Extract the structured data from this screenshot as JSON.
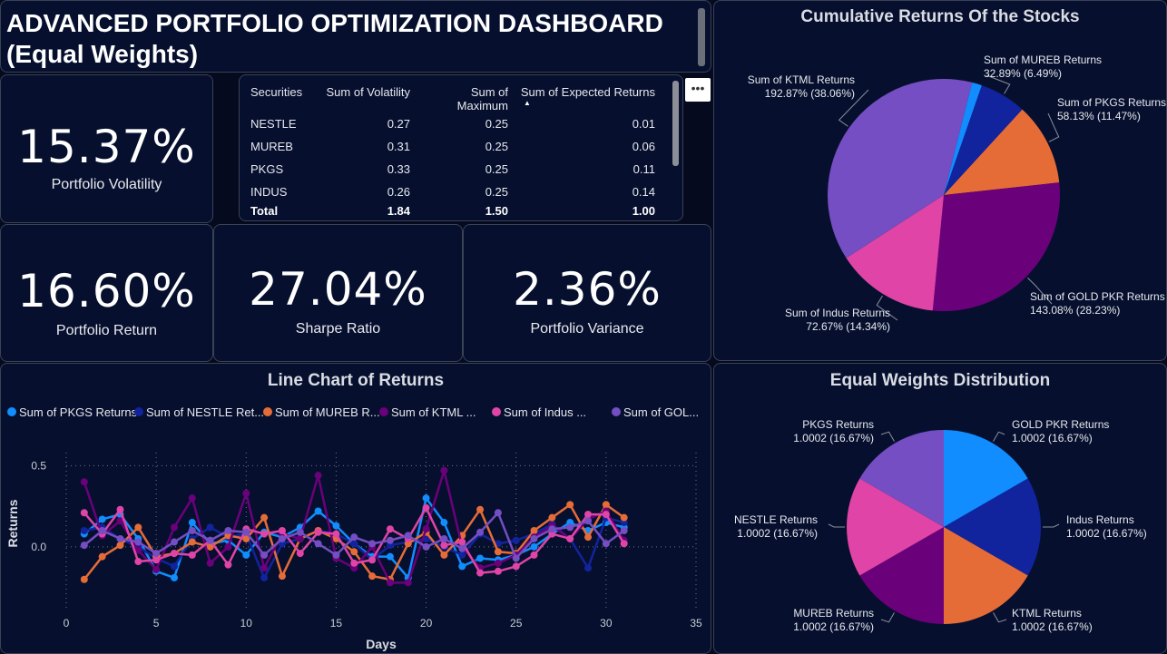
{
  "header": {
    "title_line1": "ADVANCED PORTFOLIO OPTIMIZATION DASHBOARD",
    "title_line2": "(Equal Weights)"
  },
  "kpis": {
    "volatility": {
      "value": "15.37%",
      "label": "Portfolio Volatility"
    },
    "return": {
      "value": "16.60%",
      "label": "Portfolio Return"
    },
    "sharpe": {
      "value": "27.04%",
      "label": "Sharpe Ratio"
    },
    "variance": {
      "value": "2.36%",
      "label": "Portfolio Variance"
    }
  },
  "more_options": "•••",
  "table": {
    "headers": [
      "Securities",
      "Sum of Volatility",
      "Sum of Maximum",
      "Sum of Expected Returns"
    ],
    "rows": [
      [
        "NESTLE",
        "0.27",
        "0.25",
        "0.01"
      ],
      [
        "MUREB",
        "0.31",
        "0.25",
        "0.06"
      ],
      [
        "PKGS",
        "0.33",
        "0.25",
        "0.11"
      ],
      [
        "INDUS",
        "0.26",
        "0.25",
        "0.14"
      ]
    ],
    "total": [
      "Total",
      "1.84",
      "1.50",
      "1.00"
    ]
  },
  "colors": {
    "pkgs": "#118dff",
    "nestle": "#12239e",
    "mureb": "#e66c37",
    "ktml": "#6b007b",
    "indus": "#e044a7",
    "gold": "#744ec2",
    "background": "#050a1e",
    "panel": "#06102e"
  },
  "chart_data": [
    {
      "type": "pie",
      "title": "Cumulative Returns Of the Stocks",
      "slices": [
        {
          "label": "Sum of PKGS Returns",
          "value": 58.13,
          "display": "58.13% (11.47%)",
          "color": "#e66c37"
        },
        {
          "label": "Sum of GOLD PKR Returns",
          "value": 143.08,
          "display": "143.08% (28.23%)",
          "color": "#6b007b"
        },
        {
          "label": "Sum of Indus Returns",
          "value": 72.67,
          "display": "72.67% (14.34%)",
          "color": "#e044a7"
        },
        {
          "label": "Sum of KTML Returns",
          "value": 192.87,
          "display": "192.87% (38.06%)",
          "color": "#744ec2"
        },
        {
          "label": "Sum of NESTLE Returns",
          "value": 7.0,
          "display": "",
          "color": "#118dff"
        },
        {
          "label": "Sum of MUREB Returns",
          "value": 32.89,
          "display": "32.89% (6.49%)",
          "color": "#12239e"
        }
      ]
    },
    {
      "type": "pie",
      "title": "Equal Weights Distribution",
      "slices": [
        {
          "label": "GOLD PKR Returns",
          "value": 1.0002,
          "display": "1.0002 (16.67%)",
          "color": "#118dff"
        },
        {
          "label": "Indus Returns",
          "value": 1.0002,
          "display": "1.0002 (16.67%)",
          "color": "#12239e"
        },
        {
          "label": "KTML Returns",
          "value": 1.0002,
          "display": "1.0002 (16.67%)",
          "color": "#e66c37"
        },
        {
          "label": "MUREB Returns",
          "value": 1.0002,
          "display": "1.0002 (16.67%)",
          "color": "#6b007b"
        },
        {
          "label": "NESTLE Returns",
          "value": 1.0002,
          "display": "1.0002 (16.67%)",
          "color": "#e044a7"
        },
        {
          "label": "PKGS Returns",
          "value": 1.0002,
          "display": "1.0002 (16.67%)",
          "color": "#744ec2"
        }
      ]
    },
    {
      "type": "line",
      "title": "Line Chart of Returns",
      "xlabel": "Days",
      "ylabel": "Returns",
      "xlim": [
        0,
        35
      ],
      "ylim": [
        -0.38,
        0.58
      ],
      "xticks": [
        0,
        5,
        10,
        15,
        20,
        25,
        30,
        35
      ],
      "yticks": [
        0.0,
        0.5
      ],
      "ytick_labels": [
        "0.0",
        "0.5"
      ],
      "grid": true,
      "legend_position": "top-left",
      "x": [
        1,
        2,
        3,
        4,
        5,
        6,
        7,
        8,
        9,
        10,
        11,
        12,
        13,
        14,
        15,
        16,
        17,
        18,
        19,
        20,
        21,
        22,
        23,
        24,
        25,
        26,
        27,
        28,
        29,
        30,
        31
      ],
      "series": [
        {
          "name": "Sum of PKGS Returns",
          "legend": "Sum of PKGS Returns",
          "color": "#118dff",
          "values": [
            0.08,
            0.17,
            0.2,
            0.05,
            -0.15,
            -0.19,
            0.15,
            0.02,
            0.04,
            -0.05,
            0.09,
            0.06,
            0.12,
            0.22,
            0.13,
            0.02,
            -0.06,
            -0.06,
            -0.19,
            0.3,
            0.15,
            -0.12,
            -0.07,
            -0.08,
            -0.05,
            0.0,
            0.08,
            0.15,
            0.1,
            0.15,
            0.12
          ]
        },
        {
          "name": "Sum of NESTLE Returns",
          "legend": "Sum of NESTLE Ret...",
          "color": "#12239e",
          "values": [
            0.1,
            0.12,
            0.05,
            0.0,
            -0.07,
            -0.12,
            0.05,
            0.12,
            0.06,
            0.08,
            -0.19,
            0.02,
            0.05,
            0.1,
            0.08,
            0.02,
            -0.08,
            0.01,
            0.03,
            0.05,
            0.0,
            -0.05,
            0.08,
            0.02,
            0.04,
            0.08,
            0.14,
            0.05,
            -0.13,
            0.18,
            0.15
          ]
        },
        {
          "name": "Sum of MUREB Returns",
          "legend": "Sum of MUREB R...",
          "color": "#e66c37",
          "values": [
            -0.2,
            -0.06,
            0.01,
            0.12,
            -0.06,
            -0.04,
            0.03,
            0.0,
            0.07,
            0.05,
            0.18,
            -0.18,
            0.05,
            0.1,
            0.05,
            -0.03,
            -0.18,
            -0.2,
            0.02,
            0.09,
            -0.05,
            0.07,
            0.23,
            -0.03,
            -0.04,
            0.1,
            0.18,
            0.26,
            0.06,
            0.26,
            0.18
          ]
        },
        {
          "name": "Sum of KTML Returns",
          "legend": "Sum of KTML ...",
          "color": "#6b007b",
          "values": [
            0.4,
            0.07,
            0.16,
            -0.02,
            -0.14,
            0.12,
            0.3,
            -0.1,
            0.0,
            0.33,
            -0.13,
            0.08,
            0.05,
            0.44,
            -0.07,
            -0.13,
            0.0,
            -0.22,
            -0.22,
            0.11,
            0.47,
            0.0,
            -0.13,
            -0.1,
            -0.05,
            0.06,
            0.13,
            0.05,
            0.17,
            0.22,
            0.04
          ]
        },
        {
          "name": "Sum of Indus Returns",
          "legend": "Sum of Indus ...",
          "color": "#e044a7",
          "values": [
            0.21,
            0.08,
            0.23,
            -0.09,
            -0.08,
            -0.04,
            -0.05,
            0.04,
            -0.11,
            0.11,
            0.08,
            0.1,
            -0.04,
            0.09,
            0.08,
            -0.1,
            -0.08,
            0.11,
            0.05,
            0.24,
            0.01,
            0.03,
            -0.16,
            -0.15,
            -0.12,
            -0.05,
            0.08,
            0.05,
            0.2,
            0.2,
            0.02
          ]
        },
        {
          "name": "Sum of GOLD PKR Returns",
          "legend": "Sum of GOL...",
          "color": "#744ec2",
          "values": [
            0.01,
            0.1,
            0.05,
            0.03,
            -0.04,
            0.03,
            0.1,
            0.04,
            0.1,
            0.09,
            -0.05,
            0.05,
            0.09,
            0.02,
            -0.05,
            0.06,
            0.02,
            0.04,
            0.07,
            0.0,
            0.05,
            -0.01,
            0.09,
            0.21,
            -0.07,
            0.05,
            0.11,
            0.12,
            0.16,
            0.02,
            0.1
          ]
        }
      ]
    }
  ]
}
